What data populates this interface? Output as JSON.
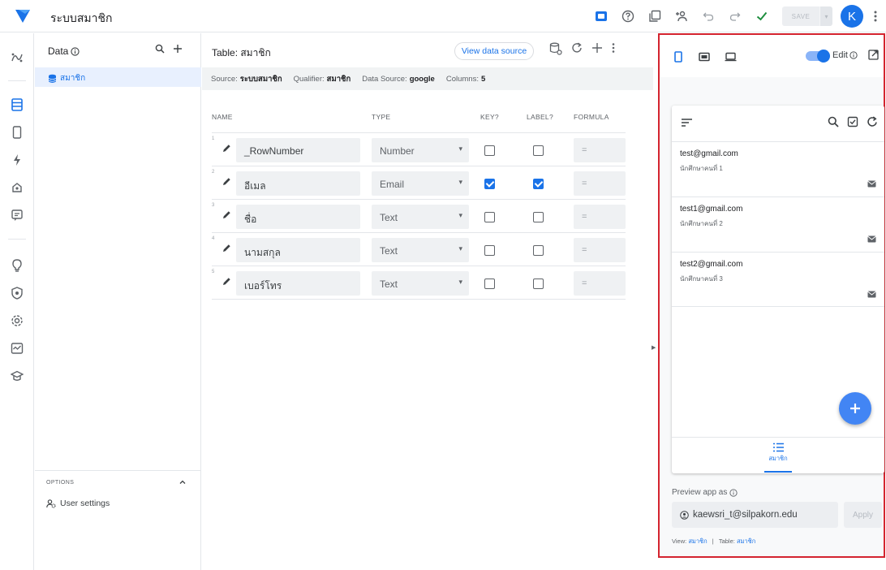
{
  "app": {
    "title": "ระบบสมาชิก"
  },
  "topbar": {
    "save_label": "SAVE",
    "avatar_initial": "K"
  },
  "data_panel": {
    "title": "Data",
    "tables": [
      {
        "label": "สมาชิก"
      }
    ],
    "options_label": "OPTIONS",
    "user_settings_label": "User settings"
  },
  "main": {
    "table_title": "Table: สมาชิก",
    "view_source_label": "View data source",
    "info": [
      {
        "label": "Source:",
        "value": "ระบบสมาชิก"
      },
      {
        "label": "Qualifier:",
        "value": "สมาชิก"
      },
      {
        "label": "Data Source:",
        "value": "google"
      },
      {
        "label": "Columns:",
        "value": "5"
      }
    ],
    "headers": {
      "name": "NAME",
      "type": "TYPE",
      "key": "KEY?",
      "label": "LABEL?",
      "formula": "FORMULA"
    },
    "columns": [
      {
        "num": "1",
        "name": "_RowNumber",
        "type": "Number",
        "key": false,
        "label": false,
        "formula": "="
      },
      {
        "num": "2",
        "name": "อีเมล",
        "type": "Email",
        "key": true,
        "label": true,
        "formula": "="
      },
      {
        "num": "3",
        "name": "ชื่อ",
        "type": "Text",
        "key": false,
        "label": false,
        "formula": "="
      },
      {
        "num": "4",
        "name": "นามสกุล",
        "type": "Text",
        "key": false,
        "label": false,
        "formula": "="
      },
      {
        "num": "5",
        "name": "เบอร์โทร",
        "type": "Text",
        "key": false,
        "label": false,
        "formula": "="
      }
    ]
  },
  "preview": {
    "edit_label": "Edit",
    "edit_enabled": true,
    "records": [
      {
        "email": "test@gmail.com",
        "sub": "นักศึกษาคนที่ 1"
      },
      {
        "email": "test1@gmail.com",
        "sub": "นักศึกษาคนที่ 2"
      },
      {
        "email": "test2@gmail.com",
        "sub": "นักศึกษาคนที่ 3"
      }
    ],
    "nav_label": "สมาชิก",
    "preview_as_label": "Preview app as",
    "preview_as_value": "kaewsri_t@silpakorn.edu",
    "apply_label": "Apply",
    "footer": {
      "view_label": "View:",
      "view_value": "สมาชิก",
      "sep": "|",
      "table_label": "Table:",
      "table_value": "สมาชิก"
    }
  },
  "colors": {
    "accent": "#1a73e8",
    "highlight_border": "#d4242f",
    "selected_row": "#e8f0fe"
  }
}
